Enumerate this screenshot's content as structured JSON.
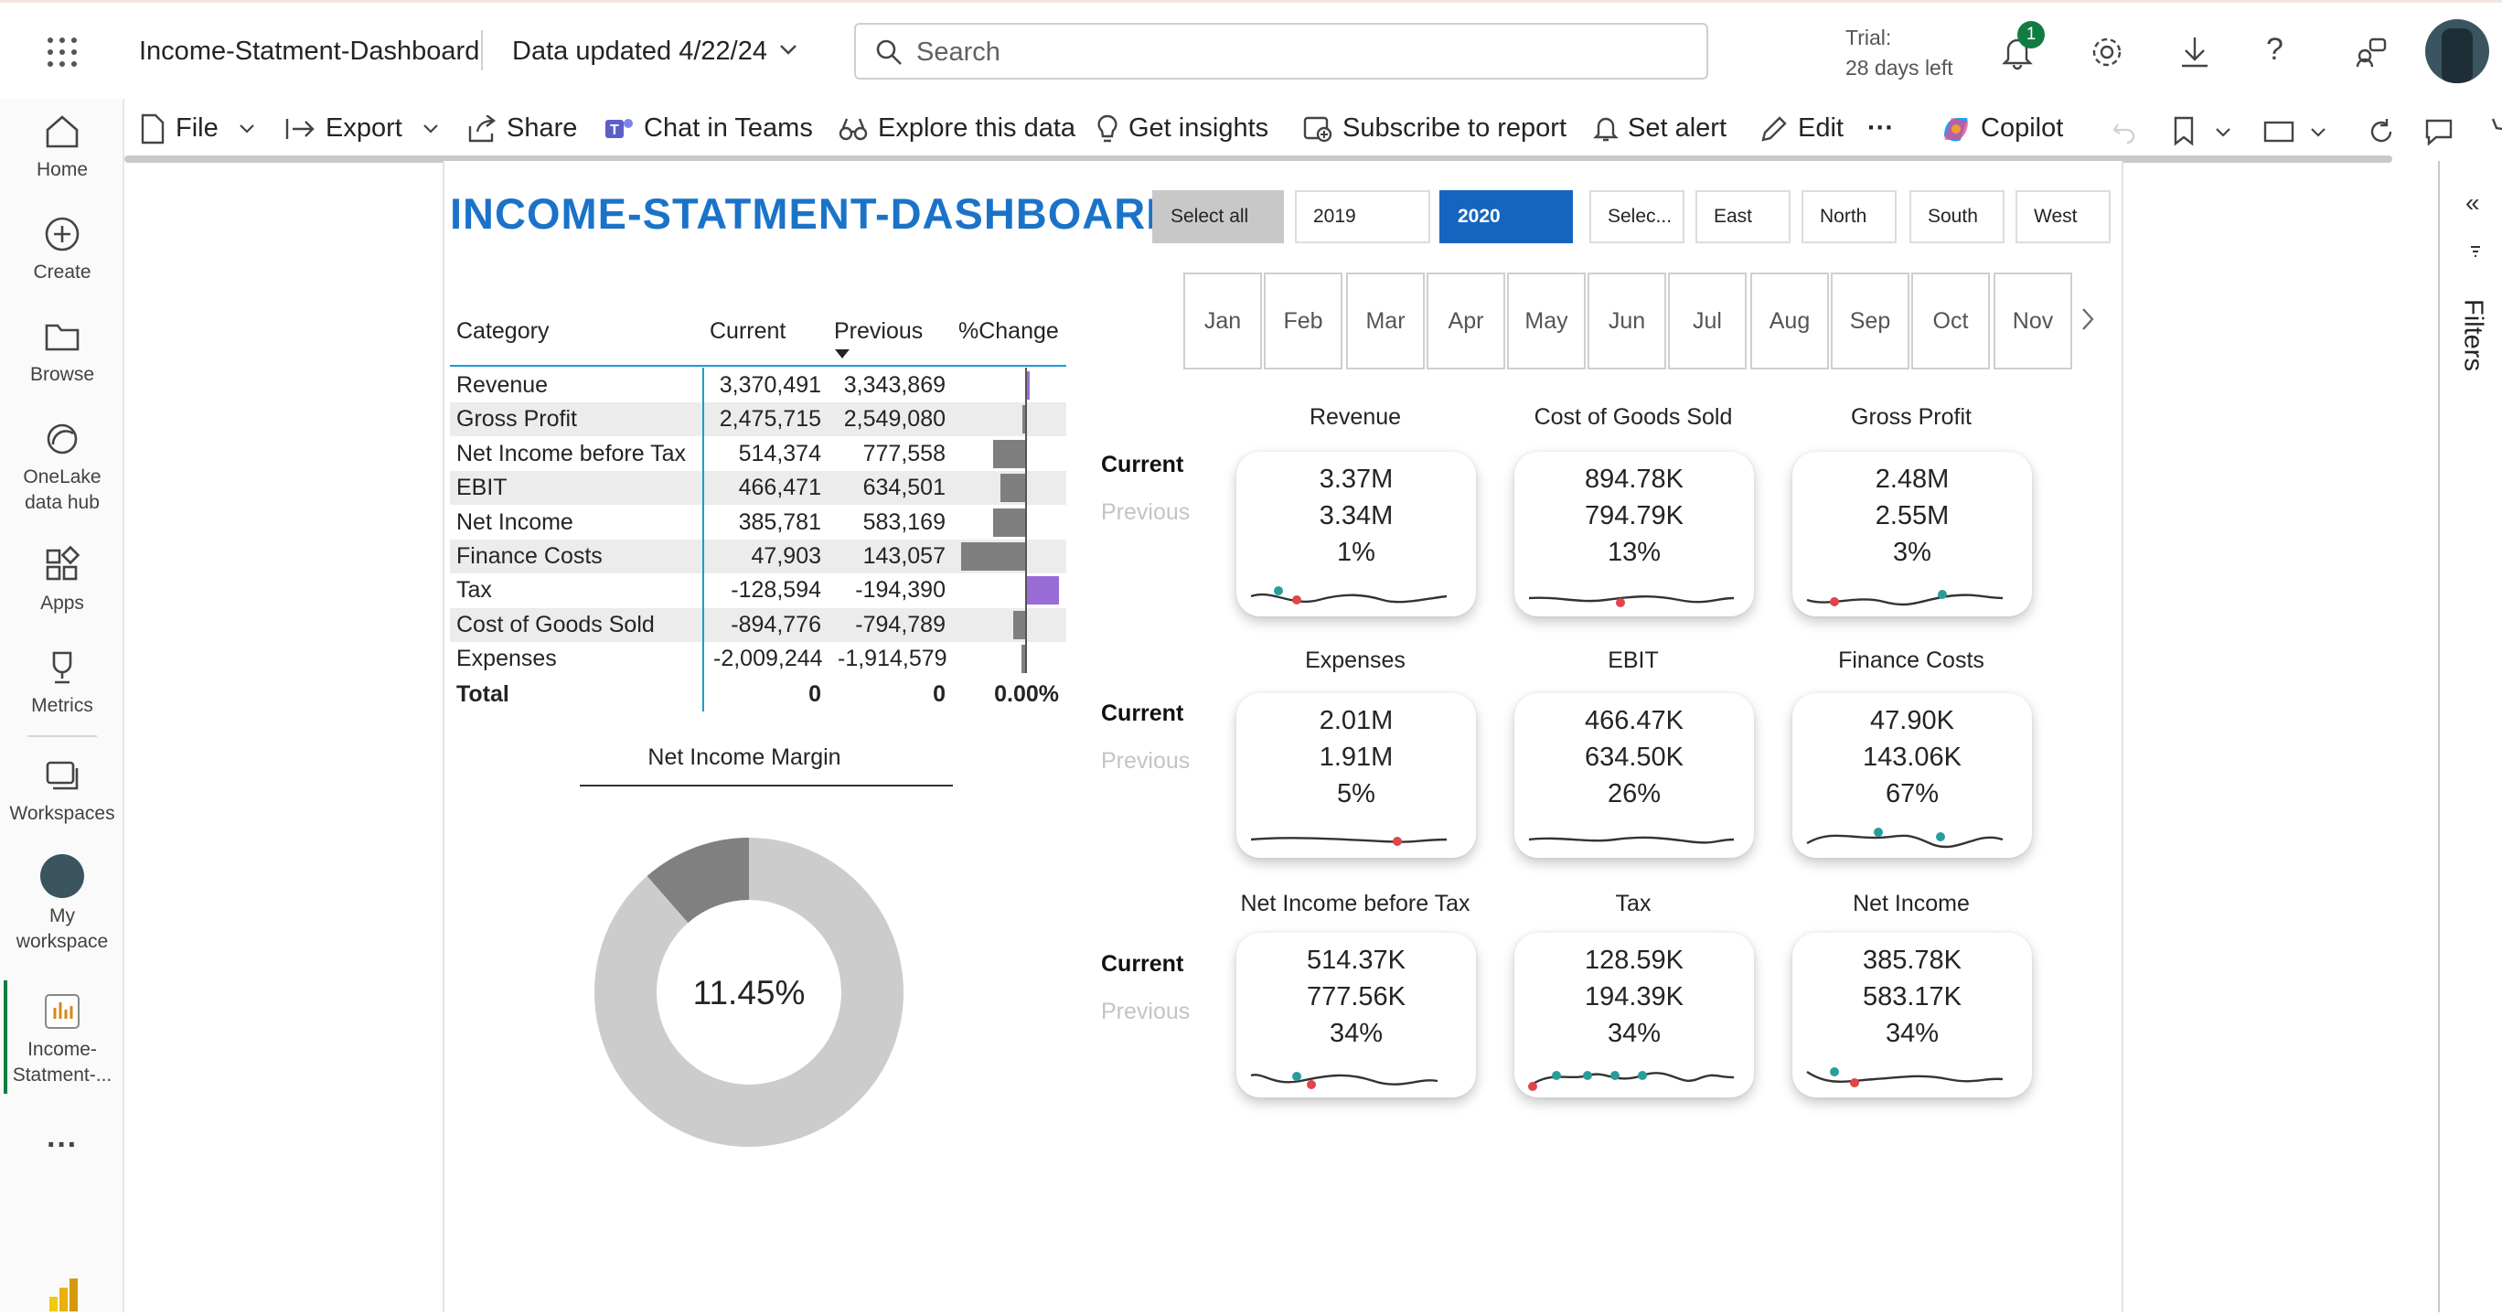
{
  "app": {
    "report_name": "Income-Statment-Dashboard",
    "data_updated": "Data updated 4/22/24",
    "search_placeholder": "Search",
    "trial_line1": "Trial:",
    "trial_line2": "28 days left",
    "notification_count": "1"
  },
  "rail": [
    {
      "label": "Home"
    },
    {
      "label": "Create"
    },
    {
      "label": "Browse"
    },
    {
      "label": "OneLake"
    },
    {
      "label": "data hub"
    },
    {
      "label": "Apps"
    },
    {
      "label": "Metrics"
    },
    {
      "label": "Workspaces"
    },
    {
      "label": "My"
    },
    {
      "label": "workspace"
    },
    {
      "label": "Income-"
    },
    {
      "label": "Statment-..."
    }
  ],
  "actions": {
    "file": "File",
    "export": "Export",
    "share": "Share",
    "chat": "Chat in Teams",
    "explore": "Explore this data",
    "insights": "Get insights",
    "subscribe": "Subscribe to report",
    "alert": "Set alert",
    "edit": "Edit",
    "more": "···",
    "copilot": "Copilot"
  },
  "filters_label": "Filters",
  "dashboard": {
    "title": "INCOME-STATMENT-DASHBOARD",
    "slicers": {
      "select_all": "Select all",
      "year_2019": "2019",
      "year_2020": "2020",
      "region_select": "Selec...",
      "east": "East",
      "north": "North",
      "south": "South",
      "west": "West"
    },
    "months": [
      "Jan",
      "Feb",
      "Mar",
      "Apr",
      "May",
      "Jun",
      "Jul",
      "Aug",
      "Sep",
      "Oct",
      "Nov"
    ],
    "table": {
      "headers": [
        "Category",
        "Current",
        "Previous",
        "%Change"
      ],
      "rows": [
        {
          "category": "Revenue",
          "current": "3,370,491",
          "previous": "3,343,869",
          "pct": 1
        },
        {
          "category": "Gross Profit",
          "current": "2,475,715",
          "previous": "2,549,080",
          "pct": -3
        },
        {
          "category": "Net Income before Tax",
          "current": "514,374",
          "previous": "777,558",
          "pct": -34
        },
        {
          "category": "EBIT",
          "current": "466,471",
          "previous": "634,501",
          "pct": -26
        },
        {
          "category": "Net Income",
          "current": "385,781",
          "previous": "583,169",
          "pct": -34
        },
        {
          "category": "Finance Costs",
          "current": "47,903",
          "previous": "143,057",
          "pct": -67
        },
        {
          "category": "Tax",
          "current": "-128,594",
          "previous": "-194,390",
          "pct": 34
        },
        {
          "category": "Cost of Goods Sold",
          "current": "-894,776",
          "previous": "-794,789",
          "pct": -13
        },
        {
          "category": "Expenses",
          "current": "-2,009,244",
          "previous": "-1,914,579",
          "pct": -5
        }
      ],
      "total": {
        "label": "Total",
        "current": "0",
        "previous": "0",
        "pct": "0.00%"
      }
    },
    "donut": {
      "title": "Net Income Margin",
      "center": "11.45%",
      "fraction": 0.1145
    },
    "kpi_labels": {
      "current": "Current",
      "previous": "Previous"
    },
    "kpis": [
      {
        "title": "Revenue",
        "current": "3.37M",
        "previous": "3.34M",
        "pct": "1%"
      },
      {
        "title": "Cost of Goods Sold",
        "current": "894.78K",
        "previous": "794.79K",
        "pct": "13%"
      },
      {
        "title": "Gross Profit",
        "current": "2.48M",
        "previous": "2.55M",
        "pct": "3%"
      },
      {
        "title": "Expenses",
        "current": "2.01M",
        "previous": "1.91M",
        "pct": "5%"
      },
      {
        "title": "EBIT",
        "current": "466.47K",
        "previous": "634.50K",
        "pct": "26%"
      },
      {
        "title": "Finance Costs",
        "current": "47.90K",
        "previous": "143.06K",
        "pct": "67%"
      },
      {
        "title": "Net Income before Tax",
        "current": "514.37K",
        "previous": "777.56K",
        "pct": "34%"
      },
      {
        "title": "Tax",
        "current": "128.59K",
        "previous": "194.39K",
        "pct": "34%"
      },
      {
        "title": "Net Income",
        "current": "385.78K",
        "previous": "583.17K",
        "pct": "34%"
      }
    ]
  },
  "colors": {
    "title_blue": "#1a73c8",
    "active_slicer": "#1565c0",
    "bar_gray": "#7f7f7f",
    "bar_purple": "#9a6cd6",
    "donut_main": "#cccccc",
    "donut_slice": "#808080",
    "spark_teal": "#2a9d9b",
    "spark_red": "#e0454a"
  }
}
